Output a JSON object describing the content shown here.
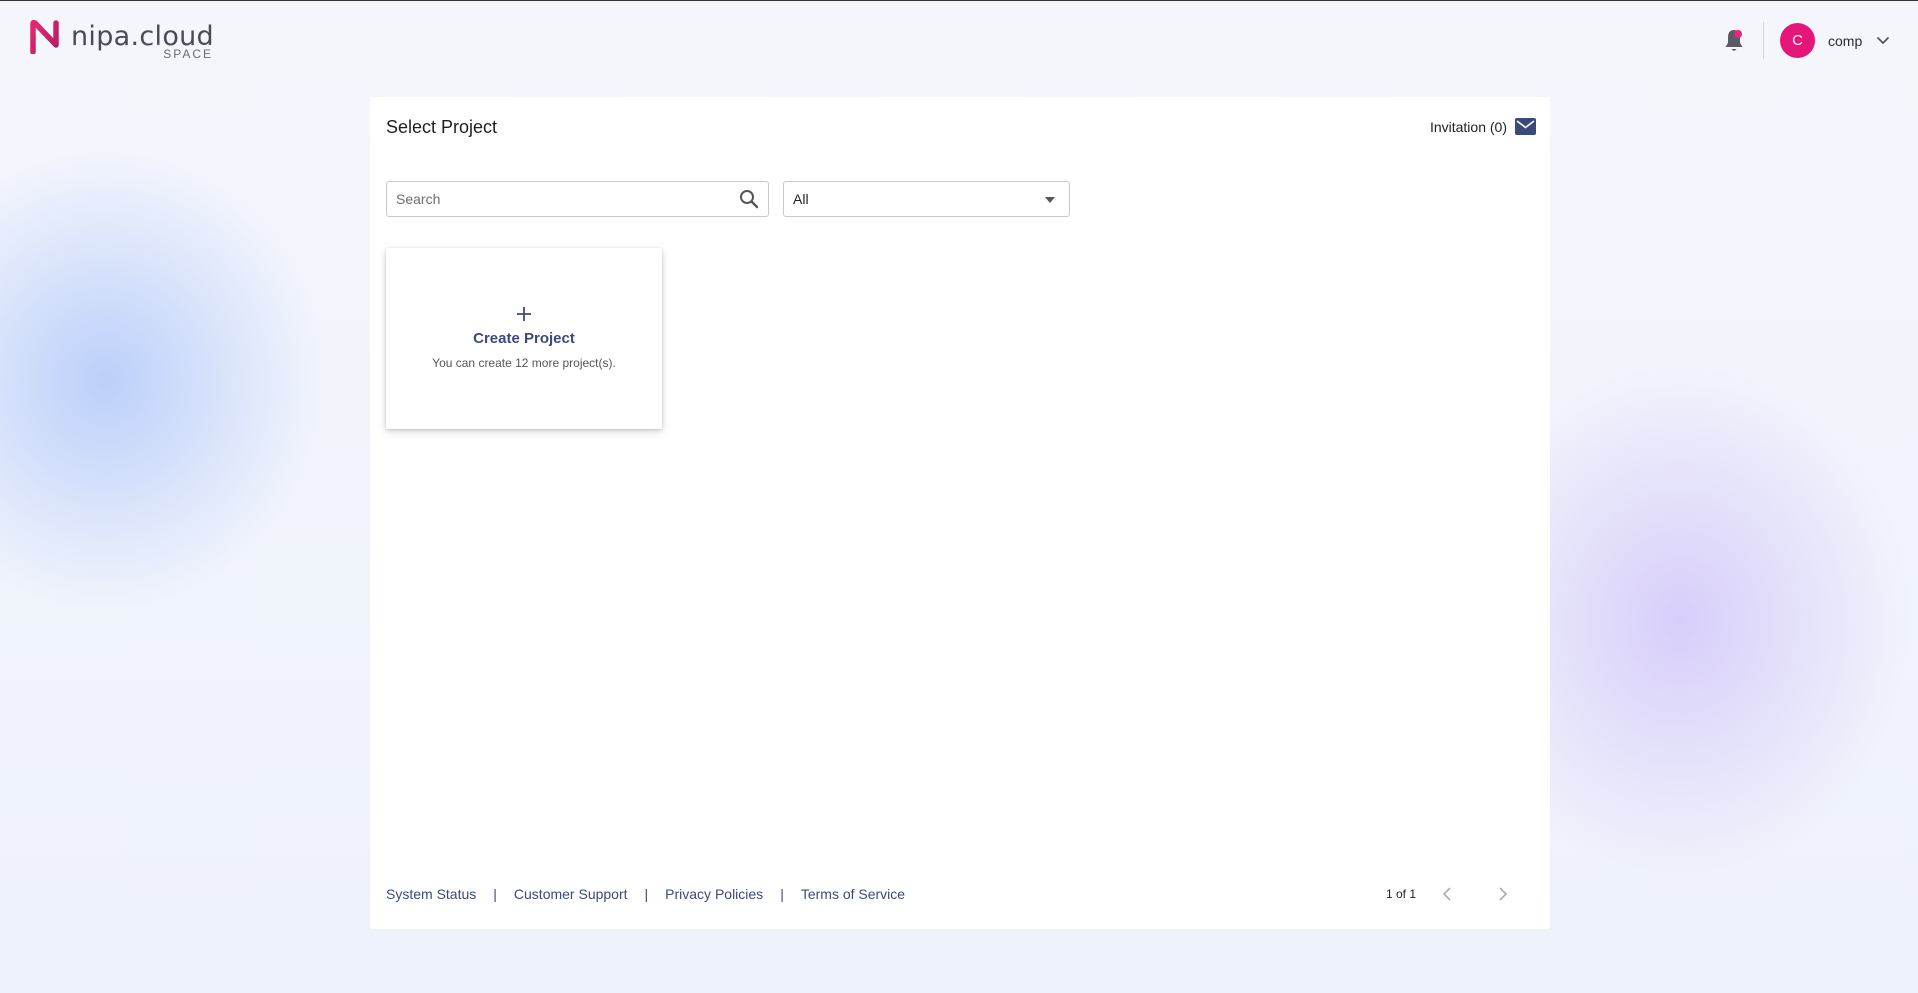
{
  "header": {
    "logo": {
      "word": "nipa.cloud",
      "sub": "SPACE",
      "icon": "nipa-logo-icon",
      "brand_color": "#d6246e"
    },
    "notification": {
      "icon": "bell-icon",
      "has_unread": true,
      "dot_color": "#e8247d"
    },
    "user": {
      "initial": "C",
      "name": "comp",
      "avatar_color": "#e5157a",
      "menu_icon": "chevron-down-icon"
    }
  },
  "panel": {
    "title": "Select Project",
    "invitation": {
      "label": "Invitation (0)",
      "icon": "mail-icon"
    },
    "search": {
      "placeholder": "Search",
      "value": "",
      "icon": "search-icon"
    },
    "filter": {
      "selected": "All",
      "icon": "caret-down-icon"
    },
    "create_card": {
      "icon": "plus-icon",
      "title": "Create Project",
      "subtitle": "You can create 12 more project(s)."
    },
    "footer": {
      "links": [
        "System Status",
        "Customer Support",
        "Privacy Policies",
        "Terms of Service"
      ],
      "separator": "|"
    },
    "pagination": {
      "label": "1 of 1",
      "prev_icon": "chevron-left-icon",
      "next_icon": "chevron-right-icon"
    }
  },
  "colors": {
    "accent_text": "#3c4a79",
    "brand_pink": "#e5157a",
    "panel_bg": "#ffffff"
  }
}
